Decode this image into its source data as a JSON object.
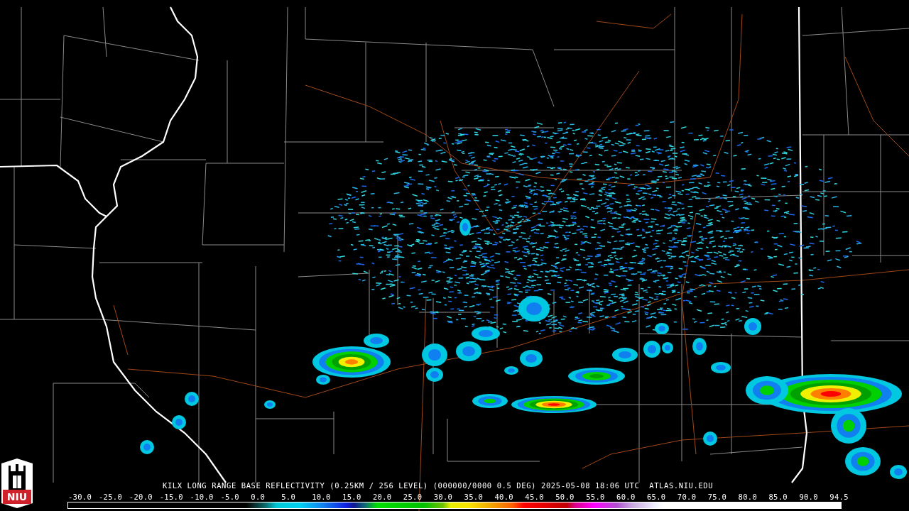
{
  "logo": {
    "text": "NIU"
  },
  "caption": "KILX LONG RANGE BASE REFLECTIVITY (0.25KM / 256 LEVEL) (000000/0000 0.5 DEG) 2025-05-08 18:06 UTC  ATLAS.NIU.EDU",
  "scale": {
    "ticks": [
      "-30.0",
      "-25.0",
      "-20.0",
      "-15.0",
      "-10.0",
      "-5.0",
      "0.0",
      "5.0",
      "10.0",
      "15.0",
      "20.0",
      "25.0",
      "30.0",
      "35.0",
      "40.0",
      "45.0",
      "50.0",
      "55.0",
      "60.0",
      "65.0",
      "70.0",
      "75.0",
      "80.0",
      "85.0",
      "90.0",
      "94.5"
    ]
  }
}
